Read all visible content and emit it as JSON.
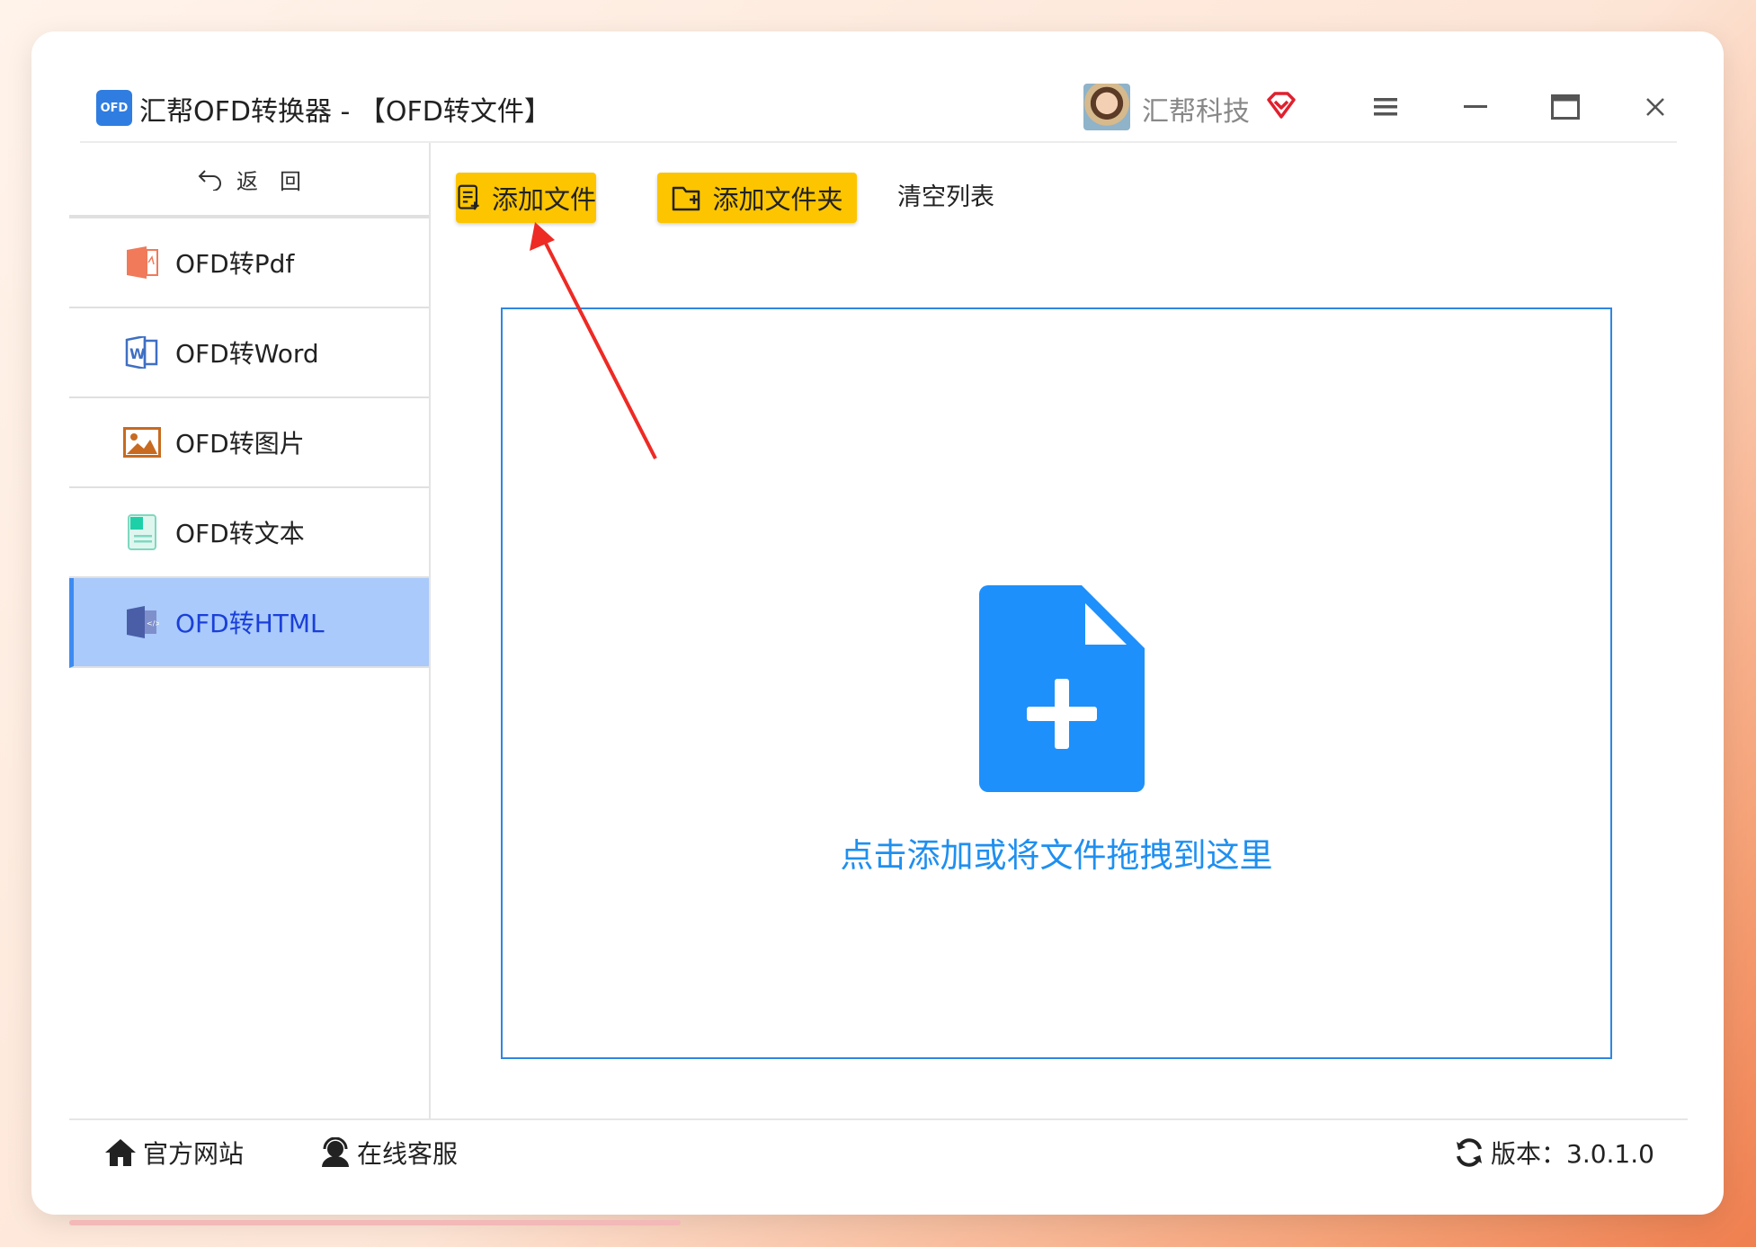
{
  "app": {
    "logo_text": "OFD",
    "title": "汇帮OFD转换器 - 【OFD转文件】",
    "user_name": "汇帮科技"
  },
  "window_controls": {
    "icons": [
      "menu-icon",
      "minimize-icon",
      "maximize-icon",
      "close-icon"
    ]
  },
  "sidebar": {
    "back_label": "返　回",
    "items": [
      {
        "label": "OFD转Pdf",
        "icon": "pdf-file-icon",
        "active": false
      },
      {
        "label": "OFD转Word",
        "icon": "word-file-icon",
        "active": false
      },
      {
        "label": "OFD转图片",
        "icon": "image-file-icon",
        "active": false
      },
      {
        "label": "OFD转文本",
        "icon": "text-file-icon",
        "active": false
      },
      {
        "label": "OFD转HTML",
        "icon": "html-file-icon",
        "active": true
      }
    ]
  },
  "toolbar": {
    "add_file": "添加文件",
    "add_folder": "添加文件夹",
    "clear_list": "清空列表"
  },
  "dropzone": {
    "text": "点击添加或将文件拖拽到这里"
  },
  "footer": {
    "website": "官方网站",
    "support": "在线客服",
    "version": "版本：3.0.1.0"
  },
  "colors": {
    "accent_yellow": "#fcc500",
    "active_nav_bg": "#a9cafb",
    "active_nav_text": "#1b3fd8",
    "dropzone_blue": "#1f8ff0",
    "annotation_red": "#ee2a24"
  }
}
